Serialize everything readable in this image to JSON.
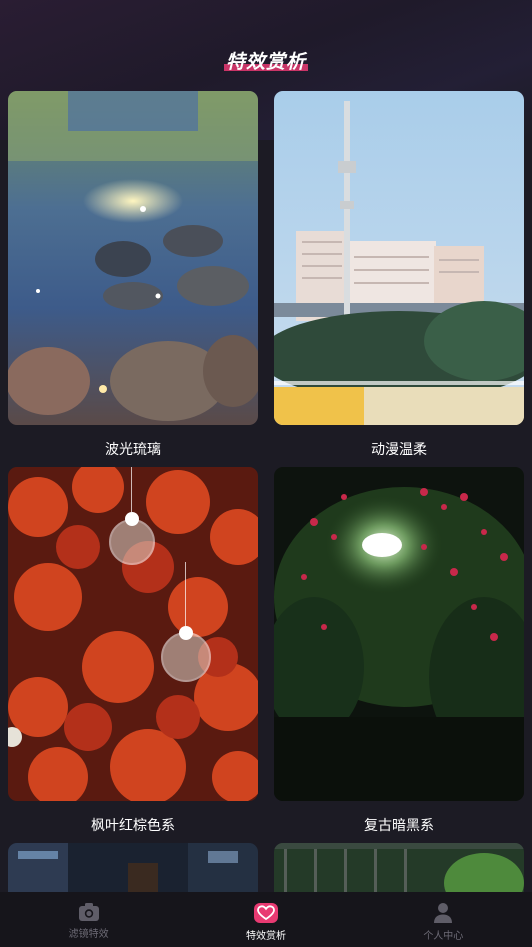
{
  "header": {
    "title": "特效赏析"
  },
  "cards": [
    {
      "label": "波光琉璃"
    },
    {
      "label": "动漫温柔"
    },
    {
      "label": "枫叶红棕色系"
    },
    {
      "label": "复古暗黑系"
    }
  ],
  "tabbar": {
    "items": [
      {
        "label": "滤镜特效",
        "icon": "camera-icon",
        "active": false
      },
      {
        "label": "特效赏析",
        "icon": "heart-icon",
        "active": true
      },
      {
        "label": "个人中心",
        "icon": "person-icon",
        "active": false
      }
    ]
  },
  "colors": {
    "accent": "#e83a72",
    "background": "#1c1b24",
    "tabbar": "#16151b"
  }
}
